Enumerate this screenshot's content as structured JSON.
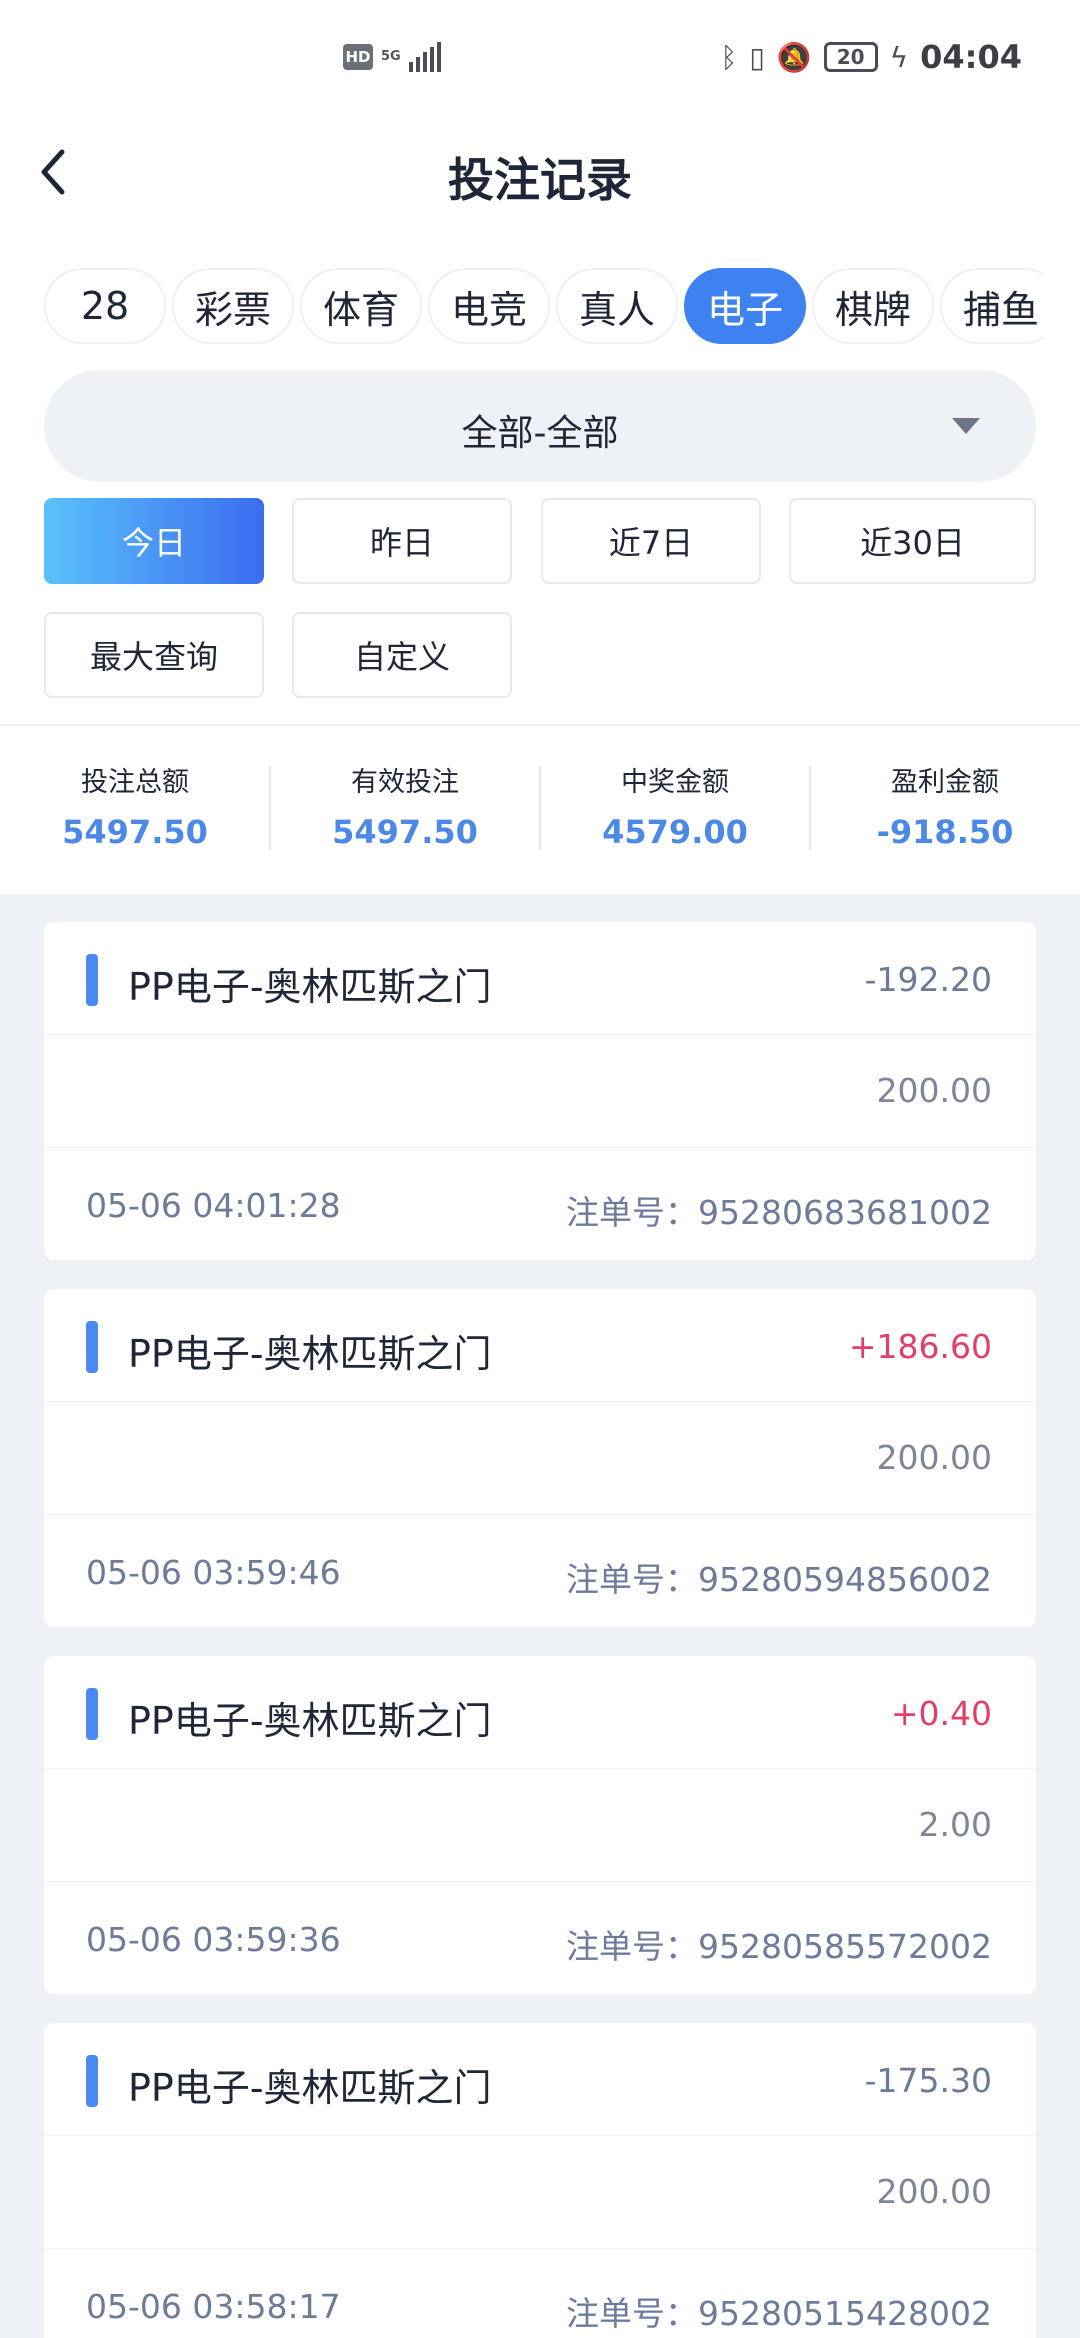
{
  "status_bar": {
    "hd": "HD",
    "network": "5G",
    "battery": "20",
    "time": "04:04",
    "icons": [
      "bluetooth-icon",
      "vibrate-icon",
      "mute-bell-icon",
      "charging-icon"
    ]
  },
  "header": {
    "title": "投注记录",
    "back_icon": "chevron-left-icon"
  },
  "tabs": [
    {
      "label": "28"
    },
    {
      "label": "彩票"
    },
    {
      "label": "体育"
    },
    {
      "label": "电竞"
    },
    {
      "label": "真人"
    },
    {
      "label": "电子",
      "active": true
    },
    {
      "label": "棋牌"
    },
    {
      "label": "捕鱼"
    }
  ],
  "filter": {
    "selected": "全部-全部",
    "caret_icon": "caret-down-icon"
  },
  "date_filters": [
    {
      "label": "今日",
      "active": true
    },
    {
      "label": "昨日"
    },
    {
      "label": "近7日"
    },
    {
      "label": "近30日"
    },
    {
      "label": "最大查询"
    },
    {
      "label": "自定义"
    }
  ],
  "summary": [
    {
      "label": "投注总额",
      "value": "5497.50"
    },
    {
      "label": "有效投注",
      "value": "5497.50"
    },
    {
      "label": "中奖金额",
      "value": "4579.00"
    },
    {
      "label": "盈利金额",
      "value": "-918.50"
    }
  ],
  "records": [
    {
      "title": "PP电子-奥林匹斯之门",
      "profit": "-192.20",
      "positive": false,
      "amount": "200.00",
      "time": "05-06 04:01:28",
      "order": "注单号：95280683681002"
    },
    {
      "title": "PP电子-奥林匹斯之门",
      "profit": "+186.60",
      "positive": true,
      "amount": "200.00",
      "time": "05-06 03:59:46",
      "order": "注单号：95280594856002"
    },
    {
      "title": "PP电子-奥林匹斯之门",
      "profit": "+0.40",
      "positive": true,
      "amount": "2.00",
      "time": "05-06 03:59:36",
      "order": "注单号：95280585572002"
    },
    {
      "title": "PP电子-奥林匹斯之门",
      "profit": "-175.30",
      "positive": false,
      "amount": "200.00",
      "time": "05-06 03:58:17",
      "order": "注单号：95280515428002"
    }
  ],
  "colors": {
    "accent": "#3d82f0",
    "positive": "#e23f68",
    "summary_value": "#4c88e6"
  }
}
